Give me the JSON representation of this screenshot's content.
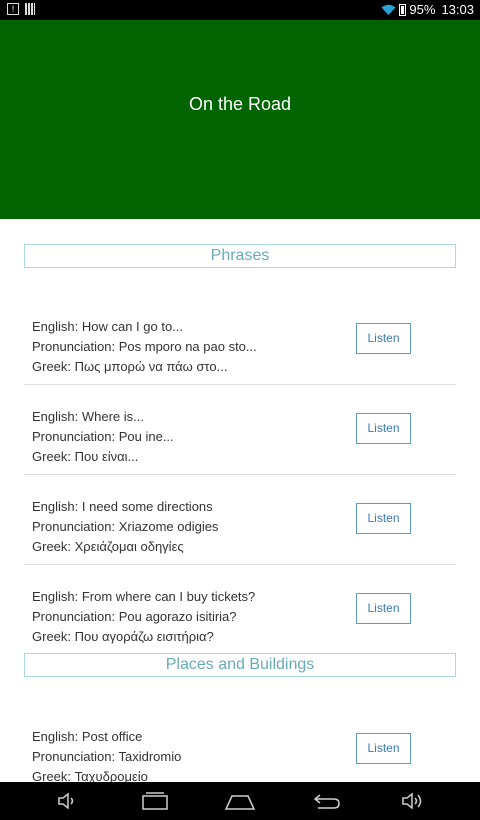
{
  "status_bar": {
    "battery": "95%",
    "time": "13:03"
  },
  "header": {
    "title": "On the Road"
  },
  "sections": [
    {
      "title": "Phrases"
    },
    {
      "title": "Places and Buildings"
    }
  ],
  "phrases": [
    {
      "english": "English: How can I go to...",
      "pronunciation": "Pronunciation: Pos mporo na pao sto...",
      "greek": "Greek: Πως μπορώ να πάω στο...",
      "button": "Listen"
    },
    {
      "english": "English: Where is...",
      "pronunciation": "Pronunciation: Pou ine...",
      "greek": "Greek: Που είναι...",
      "button": "Listen"
    },
    {
      "english": "English: I need some directions",
      "pronunciation": "Pronunciation: Xriazome odigies",
      "greek": "Greek: Χρειάζομαι οδηγίες",
      "button": "Listen"
    },
    {
      "english": "English: From where can I buy tickets?",
      "pronunciation": "Pronunciation: Pou agorazo isitiria?",
      "greek": "Greek: Που αγοράζω εισιτήρια?",
      "button": "Listen"
    }
  ],
  "places": [
    {
      "english": "English: Post office",
      "pronunciation": "Pronunciation: Taxidromio",
      "greek": "Greek: Ταχυδρομείο",
      "button": "Listen"
    }
  ],
  "icons": {
    "status_left": [
      "notification-icon",
      "sim-icon"
    ],
    "status_right": [
      "wifi-icon",
      "battery-icon"
    ],
    "nav": [
      "volume-down-icon",
      "recent-apps-icon",
      "home-icon",
      "back-icon",
      "volume-up-icon"
    ]
  }
}
